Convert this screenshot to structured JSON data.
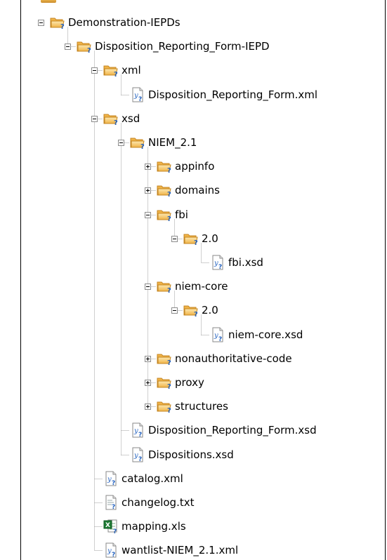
{
  "tree": {
    "nodes": [
      {
        "id": "n0",
        "label": "Demonstration-IEPDs",
        "depth": 0,
        "kind": "folder",
        "toggle": "minus"
      },
      {
        "id": "n1",
        "label": "Disposition_Reporting_Form-IEPD",
        "depth": 1,
        "kind": "folder",
        "toggle": "minus"
      },
      {
        "id": "n2",
        "label": "xml",
        "depth": 2,
        "kind": "folder",
        "toggle": "minus"
      },
      {
        "id": "n3",
        "label": "Disposition_Reporting_Form.xml",
        "depth": 3,
        "kind": "xml-file",
        "toggle": "none"
      },
      {
        "id": "n4",
        "label": "xsd",
        "depth": 2,
        "kind": "folder",
        "toggle": "minus"
      },
      {
        "id": "n5",
        "label": "NIEM_2.1",
        "depth": 3,
        "kind": "folder",
        "toggle": "minus"
      },
      {
        "id": "n6",
        "label": "appinfo",
        "depth": 4,
        "kind": "folder",
        "toggle": "plus"
      },
      {
        "id": "n7",
        "label": "domains",
        "depth": 4,
        "kind": "folder",
        "toggle": "plus"
      },
      {
        "id": "n8",
        "label": "fbi",
        "depth": 4,
        "kind": "folder",
        "toggle": "minus"
      },
      {
        "id": "n9",
        "label": "2.0",
        "depth": 5,
        "kind": "folder",
        "toggle": "minus"
      },
      {
        "id": "n10",
        "label": "fbi.xsd",
        "depth": 6,
        "kind": "xml-file",
        "toggle": "none"
      },
      {
        "id": "n11",
        "label": "niem-core",
        "depth": 4,
        "kind": "folder",
        "toggle": "minus"
      },
      {
        "id": "n12",
        "label": "2.0",
        "depth": 5,
        "kind": "folder",
        "toggle": "minus"
      },
      {
        "id": "n13",
        "label": "niem-core.xsd",
        "depth": 6,
        "kind": "xml-file",
        "toggle": "none"
      },
      {
        "id": "n14",
        "label": "nonauthoritative-code",
        "depth": 4,
        "kind": "folder",
        "toggle": "plus"
      },
      {
        "id": "n15",
        "label": "proxy",
        "depth": 4,
        "kind": "folder",
        "toggle": "plus"
      },
      {
        "id": "n16",
        "label": "structures",
        "depth": 4,
        "kind": "folder",
        "toggle": "plus"
      },
      {
        "id": "n17",
        "label": "Disposition_Reporting_Form.xsd",
        "depth": 3,
        "kind": "xml-file",
        "toggle": "none"
      },
      {
        "id": "n18",
        "label": "Dispositions.xsd",
        "depth": 3,
        "kind": "xml-file",
        "toggle": "none"
      },
      {
        "id": "n19",
        "label": "catalog.xml",
        "depth": 2,
        "kind": "xml-file",
        "toggle": "none"
      },
      {
        "id": "n20",
        "label": "changelog.txt",
        "depth": 2,
        "kind": "text-file",
        "toggle": "none"
      },
      {
        "id": "n21",
        "label": "mapping.xls",
        "depth": 2,
        "kind": "excel-file",
        "toggle": "none"
      },
      {
        "id": "n22",
        "label": "wantlist-NIEM_2.1.xml",
        "depth": 2,
        "kind": "xml-file",
        "toggle": "none"
      }
    ]
  },
  "icons": {
    "folder": "folder-question-icon",
    "xml-file": "xml-file-icon",
    "text-file": "text-file-icon",
    "excel-file": "excel-file-icon"
  },
  "colors": {
    "folder": "#f0b347",
    "folder_dark": "#c48622",
    "badge": "#1f5fbf",
    "excel": "#1e7b34",
    "connector": "#a0a0a0"
  }
}
